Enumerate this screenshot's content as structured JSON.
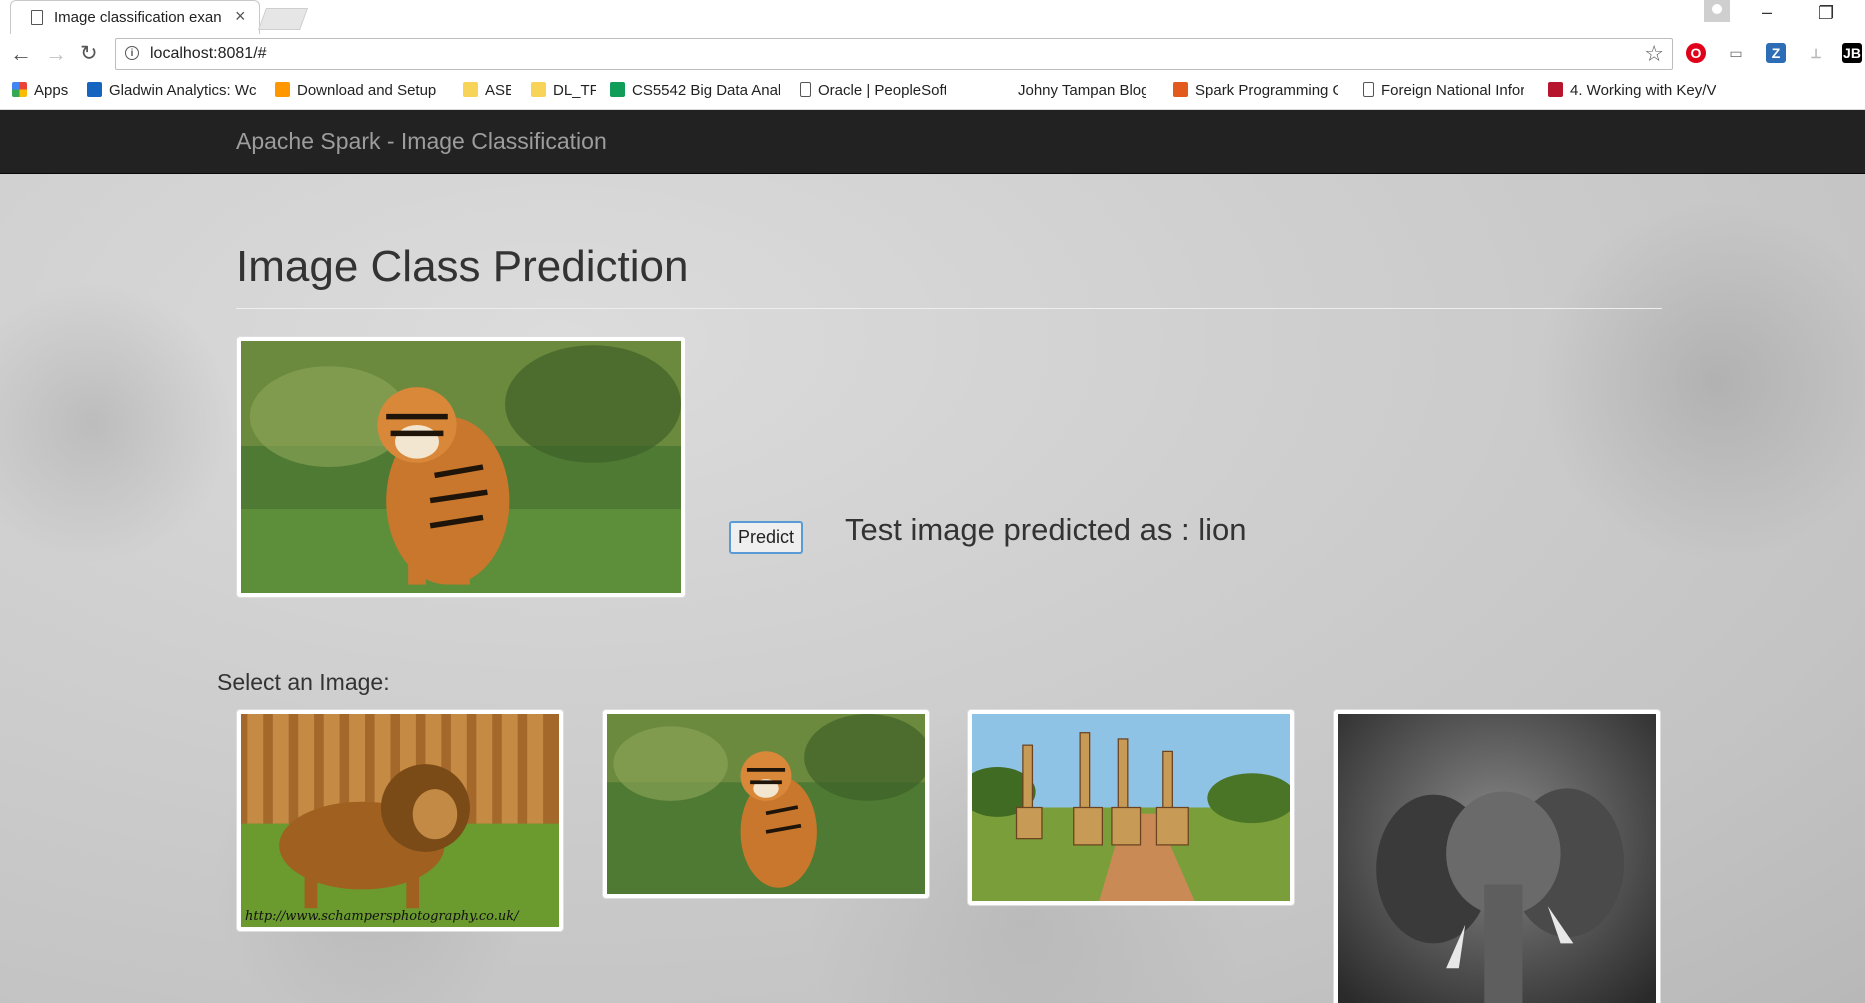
{
  "browser": {
    "tab_title": "Image classification exan",
    "address": "localhost:8081/#",
    "window_controls": {
      "minimize": "–",
      "restore": "❐"
    },
    "bookmarks": [
      {
        "label": "Apps",
        "icon": "apps-grid-icon",
        "color": "#4285f4"
      },
      {
        "label": "Gladwin Analytics: Wc",
        "icon": "gladwin-g-icon",
        "color": "#1565c0"
      },
      {
        "label": "Download and Setup",
        "icon": "tensorflow-icon",
        "color": "#ff9800"
      },
      {
        "label": "ASE",
        "icon": "folder-icon",
        "color": "#f7d358"
      },
      {
        "label": "DL_TF",
        "icon": "folder-icon",
        "color": "#f7d358"
      },
      {
        "label": "CS5542 Big Data Anal",
        "icon": "sheets-icon",
        "color": "#0f9d58"
      },
      {
        "label": "Oracle | PeopleSoft En",
        "icon": "page-icon",
        "color": "#ffffff"
      },
      {
        "label": "Johny Tampan Blogge",
        "icon": "blank-icon",
        "color": "#ffffff"
      },
      {
        "label": "Spark Programming G",
        "icon": "spark-star-icon",
        "color": "#e25a1c"
      },
      {
        "label": "Foreign National Infor",
        "icon": "page-icon",
        "color": "#ffffff"
      },
      {
        "label": "4. Working with Key/V",
        "icon": "oreilly-icon",
        "color": "#b7152d"
      }
    ],
    "extensions": [
      {
        "name": "opera-icon",
        "glyph": "O",
        "color": "#e0001a"
      },
      {
        "name": "cast-icon",
        "glyph": "▭",
        "color": "#666666"
      },
      {
        "name": "zotero-icon",
        "glyph": "Z",
        "color": "#2d6db5"
      },
      {
        "name": "pdf-icon",
        "glyph": "⟂",
        "color": "#b8b8b8"
      },
      {
        "name": "jetbrains-icon",
        "glyph": "JB",
        "color": "#000000"
      }
    ]
  },
  "app": {
    "brand": "Apache Spark - Image Classification",
    "heading": "Image Class Prediction",
    "predict_label": "Predict",
    "result_text": "Test image predicted as : lion",
    "select_label": "Select an Image:",
    "gallery": [
      {
        "name": "gallery-lion-image",
        "caption": "http://www.schampersphotography.co.uk/"
      },
      {
        "name": "gallery-tiger-image"
      },
      {
        "name": "gallery-giraffes-image"
      },
      {
        "name": "gallery-elephant-image"
      }
    ]
  }
}
